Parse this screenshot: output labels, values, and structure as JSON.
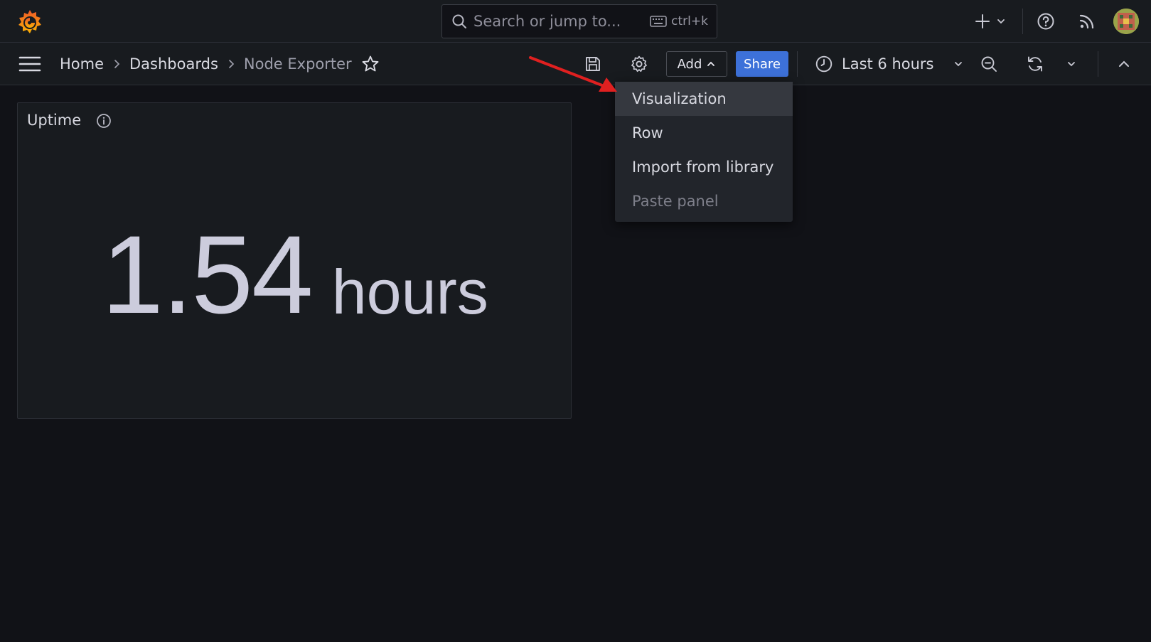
{
  "search": {
    "placeholder": "Search or jump to...",
    "shortcut": "ctrl+k"
  },
  "breadcrumb": {
    "items": [
      "Home",
      "Dashboards",
      "Node Exporter"
    ]
  },
  "toolbar": {
    "add_label": "Add",
    "share_label": "Share",
    "time_range": "Last 6 hours"
  },
  "add_menu": {
    "items": [
      {
        "label": "Visualization",
        "state": "highlighted"
      },
      {
        "label": "Row",
        "state": "normal"
      },
      {
        "label": "Import from library",
        "state": "normal"
      },
      {
        "label": "Paste panel",
        "state": "disabled"
      }
    ]
  },
  "panel": {
    "title": "Uptime",
    "value": "1.54",
    "unit": "hours"
  },
  "colors": {
    "background": "#111217",
    "bar": "#181b1f",
    "primary": "#3d71d9",
    "logo": "#f46800",
    "annotation": "#e02020"
  },
  "icons": {
    "logo": "grafana-logo",
    "search": "search-icon",
    "keyboard": "keyboard-icon",
    "new": "plus-icon",
    "help": "help-icon",
    "news": "rss-icon",
    "menu": "menu-icon",
    "favorite": "star-icon",
    "save": "save-icon",
    "settings": "gear-icon",
    "time": "clock-icon",
    "zoom_out": "zoom-out-icon",
    "refresh": "refresh-icon",
    "collapse": "chevron-up-icon",
    "panel_info": "info-icon"
  }
}
